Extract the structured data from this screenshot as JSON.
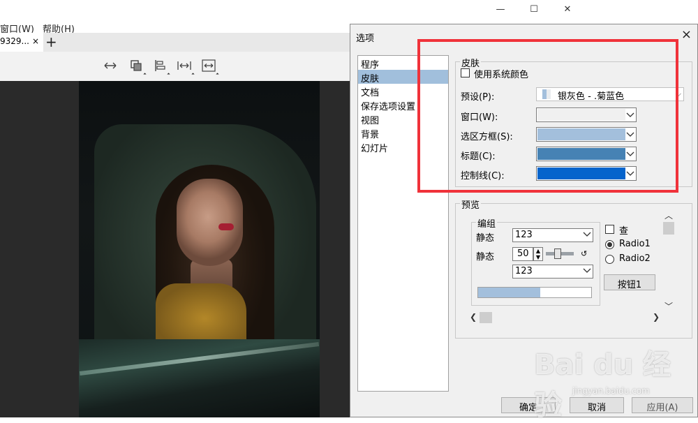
{
  "background_app": {
    "window_controls": {
      "minimize": "—",
      "maximize": "☐",
      "close": "✕"
    },
    "menu": [
      "窗口(W)",
      "帮助(H)"
    ],
    "tab": {
      "label": "9329...",
      "close": "×"
    },
    "new_tab": "+",
    "toolbar_icons": [
      "fit-width-icon",
      "crop-icon",
      "align-left-icon",
      "fit-width-bars-icon",
      "fit-screen-icon"
    ]
  },
  "dialog": {
    "title": "选项",
    "close": "×",
    "nav": [
      "程序",
      "皮肤",
      "文档",
      "保存选项设置",
      "视图",
      "背景",
      "幻灯片"
    ],
    "selected_nav": "皮肤",
    "skin": {
      "group_title": "皮肤",
      "use_system_colors": "使用系统颜色",
      "preset_label": "预设(P):",
      "preset_value": "银灰色 - .菊蓝色",
      "rows": [
        {
          "label": "窗口(W):",
          "color": "#f0f0f0"
        },
        {
          "label": "选区方框(S):",
          "color": "#a3bfdc"
        },
        {
          "label": "标题(C):",
          "color": "#4682b4"
        },
        {
          "label": "控制线(C):",
          "color": "#0564cc"
        }
      ]
    },
    "preview": {
      "group_title": "预览",
      "inner_group_title": "编组",
      "static1_label": "静态",
      "static1_value": "123",
      "static2_label": "静态",
      "spin_value": "50",
      "combo3_value": "123",
      "progress": 0.55,
      "check_label": "查",
      "radio1": "Radio1",
      "radio2": "Radio2",
      "button": "按钮1"
    },
    "buttons": {
      "ok": "确定",
      "cancel": "取消",
      "apply": "应用(A)"
    }
  },
  "watermark": {
    "brand": "Bai du 经验",
    "url": "jingyan.baidu.com"
  }
}
